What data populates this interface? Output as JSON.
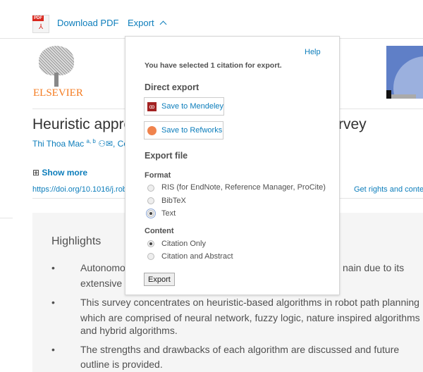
{
  "toolbar": {
    "download_pdf": "Download PDF",
    "export": "Export",
    "pdf_badge": "PDF"
  },
  "article": {
    "publisher": "ELSEVIER",
    "title_visible": "Heuristic appro",
    "title_tail": "rvey",
    "authors_visible": "Thi Thoa Mac",
    "author_sup": "a, b",
    "author_tail": ", Cos",
    "show_more": "Show more",
    "doi": "https://doi.org/10.1016/j.rob",
    "rights": "Get rights and conter"
  },
  "highlights": {
    "heading": "Highlights",
    "items": [
      {
        "lines": [
          "Autonomou",
          "extensive a"
        ],
        "tail": "nain due to its"
      },
      {
        "lines": [
          "This survey concentrates on heuristic-based algorithms in robot path planning",
          "which are comprised of neural network, fuzzy logic, nature inspired algorithms",
          "and hybrid algorithms."
        ]
      },
      {
        "lines": [
          "The strengths and drawbacks of each algorithm are discussed and future",
          "outline is provided."
        ]
      }
    ]
  },
  "export_popup": {
    "help": "Help",
    "selected": "You have selected 1 citation for export.",
    "direct_export": "Direct export",
    "mendeley": "Save to Mendeley",
    "refworks": "Save to Refworks",
    "export_file": "Export file",
    "format_label": "Format",
    "formats": [
      {
        "label": "RIS (for EndNote, Reference Manager, ProCite)",
        "checked": false
      },
      {
        "label": "BibTeX",
        "checked": false
      },
      {
        "label": "Text",
        "checked": true
      }
    ],
    "content_label": "Content",
    "contents": [
      {
        "label": "Citation Only",
        "checked": true
      },
      {
        "label": "Citation and Abstract",
        "checked": false
      }
    ],
    "export_button": "Export"
  },
  "colors": {
    "link": "#0c7dbb",
    "elsevier": "#f47b20",
    "mendeley": "#a32222",
    "panel": "#f5f5f5"
  }
}
